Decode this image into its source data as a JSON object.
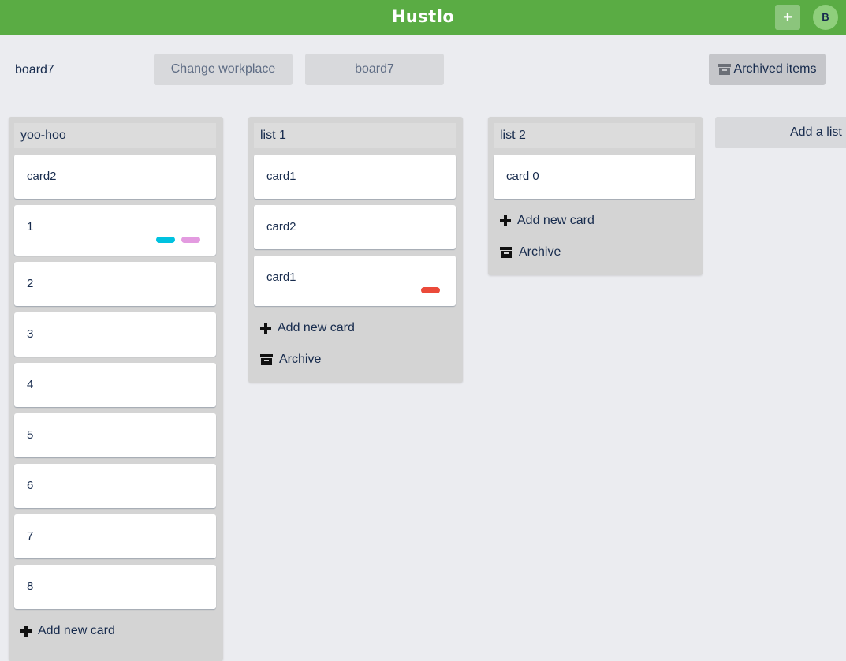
{
  "app": {
    "brand": "Hustlo",
    "add_button": "+",
    "user_initial": "B"
  },
  "header": {
    "board_name": "board7",
    "change_workplace_label": "Change workplace",
    "board_button_label": "board7",
    "archived_items_label": "Archived items"
  },
  "lists": [
    {
      "title": "yoo-hoo",
      "cards": [
        {
          "text": "card2",
          "labels": []
        },
        {
          "text": "1",
          "labels": [
            "#00c2e0",
            "#e39be0"
          ]
        },
        {
          "text": "2",
          "labels": []
        },
        {
          "text": "3",
          "labels": []
        },
        {
          "text": "4",
          "labels": []
        },
        {
          "text": "5",
          "labels": []
        },
        {
          "text": "6",
          "labels": []
        },
        {
          "text": "7",
          "labels": []
        },
        {
          "text": "8",
          "labels": []
        }
      ],
      "add_card_label": "Add new card"
    },
    {
      "title": "list 1",
      "cards": [
        {
          "text": "card1",
          "labels": []
        },
        {
          "text": "card2",
          "labels": []
        },
        {
          "text": "card1",
          "labels": [
            "#eb4a3a"
          ]
        }
      ],
      "add_card_label": "Add new card",
      "archive_label": "Archive"
    },
    {
      "title": "list 2",
      "cards": [
        {
          "text": "card 0",
          "labels": []
        }
      ],
      "add_card_label": "Add new card",
      "archive_label": "Archive"
    }
  ],
  "add_list_label": "Add a list",
  "colors": {
    "topbar": "#5aac44",
    "background": "#ebecf0",
    "list": "#d4d4d4"
  }
}
